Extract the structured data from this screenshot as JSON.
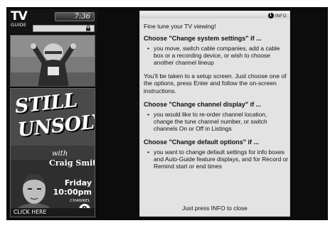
{
  "app": {
    "logo_line1": "TV",
    "logo_line2": "GUIDE",
    "clock": "7:36"
  },
  "promo": {
    "title_line1": "STILL",
    "title_line2": "UNSOLVED",
    "with": "with",
    "host": "Craig Smith",
    "day": "Friday",
    "time": "10:00pm",
    "channel_label": "CHANNEL",
    "channel_number": "9",
    "cta": "CLICK HERE"
  },
  "info_panel": {
    "tab_icon_glyph": "i",
    "tab_label": "INFO",
    "intro": "Fine tune your TV viewing!",
    "sections": [
      {
        "heading": "Choose \"Change system settings\" if ...",
        "bullet": "you move, switch cable companies, add a cable box or a recording device, or wish to choose another channel lineup"
      },
      {
        "heading": "Choose \"Change channel display\" if ...",
        "bullet": "you would like to re-order channel location, change the tune channel number, or switch channels On or Off in Listings"
      },
      {
        "heading": "Choose \"Change default options\" if ...",
        "bullet": "you want to change default settings for info boxes and Auto-Guide feature displays, and for Record or Remind start or end times"
      }
    ],
    "setup_note": "You'll be taken to a setup screen. Just choose one of the options, press Enter and follow the on-screen instructions.",
    "footer": "Just press INFO to close"
  },
  "colors": {
    "frame_bg": "#0c0c0c",
    "panel_bg": "#e3e3e3",
    "text": "#111111"
  },
  "icons": [
    "lock-icon",
    "info-icon"
  ]
}
